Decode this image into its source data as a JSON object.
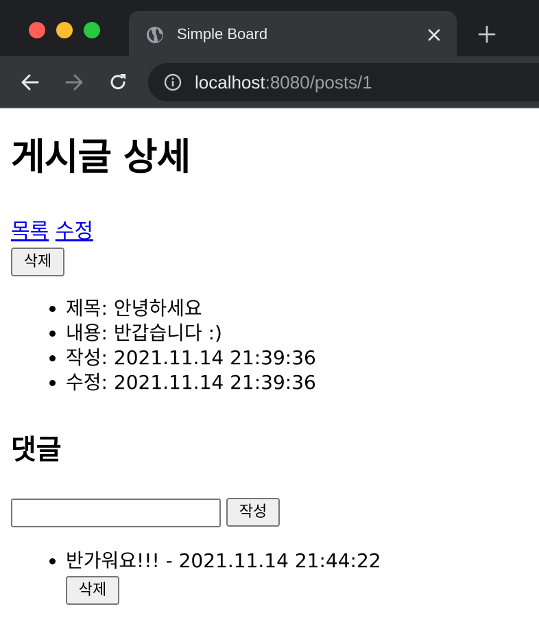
{
  "browser": {
    "tab_title": "Simple Board",
    "url_host": "localhost",
    "url_rest": ":8080/posts/1"
  },
  "page": {
    "title": "게시글 상세",
    "links": {
      "list": "목록",
      "edit": "수정"
    },
    "delete_button": "삭제",
    "details": [
      {
        "label": "제목",
        "value": "안녕하세요"
      },
      {
        "label": "내용",
        "value": "반갑습니다 :)"
      },
      {
        "label": "작성",
        "value": "2021.11.14 21:39:36"
      },
      {
        "label": "수정",
        "value": "2021.11.14 21:39:36"
      }
    ],
    "comments": {
      "title": "댓글",
      "input_value": "",
      "submit_button": "작성",
      "items": [
        {
          "text": "반가워요!!! - 2021.11.14 21:44:22",
          "delete_button": "삭제"
        }
      ]
    }
  }
}
